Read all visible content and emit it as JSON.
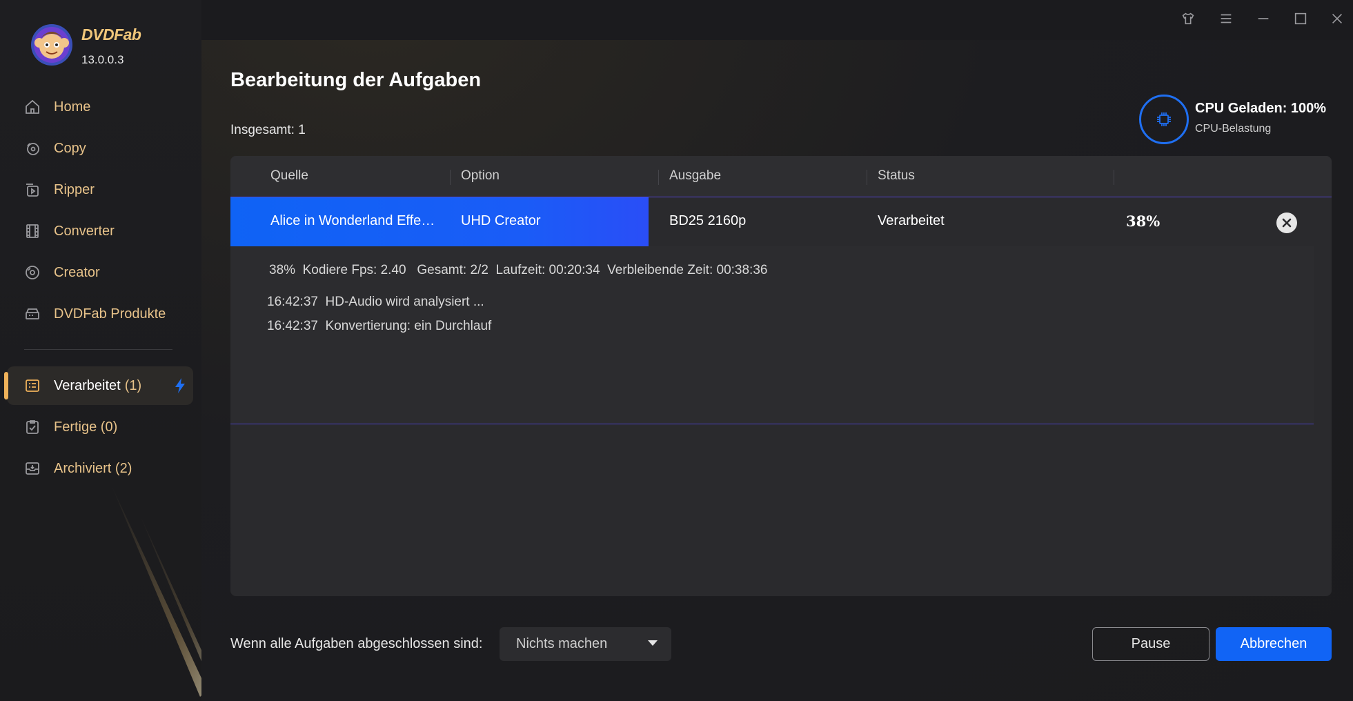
{
  "app": {
    "brand": "DVDFab",
    "version": "13.0.0.3"
  },
  "sidebar": {
    "items": [
      {
        "label": "Home",
        "icon": "home-icon"
      },
      {
        "label": "Copy",
        "icon": "copy-icon"
      },
      {
        "label": "Ripper",
        "icon": "ripper-icon"
      },
      {
        "label": "Converter",
        "icon": "converter-icon"
      },
      {
        "label": "Creator",
        "icon": "creator-icon"
      },
      {
        "label": "DVDFab Produkte",
        "icon": "products-icon"
      }
    ],
    "queue": [
      {
        "label": "Verarbeitet",
        "count": "(1)",
        "icon": "processing-list-icon",
        "active": true
      },
      {
        "label": "Fertige (0)",
        "icon": "finished-icon"
      },
      {
        "label": "Archiviert (2)",
        "icon": "archive-icon"
      }
    ]
  },
  "main": {
    "title": "Bearbeitung der Aufgaben",
    "total": "Insgesamt: 1",
    "cpu": {
      "title": "CPU Geladen: 100%",
      "subtitle": "CPU-Belastung"
    },
    "table": {
      "headers": [
        "Quelle",
        "Option",
        "Ausgabe",
        "Status"
      ],
      "rows": [
        {
          "source": "Alice in Wonderland  Effe…",
          "option": "UHD Creator",
          "output": "BD25 2160p",
          "status": "Verarbeitet",
          "percent": "38%",
          "progress": 0.38
        }
      ],
      "detail": {
        "stats": "38%  Kodiere Fps: 2.40   Gesamt: 2/2  Laufzeit: 00:20:34  Verbleibende Zeit: 00:38:36",
        "log": [
          "16:42:37  HD-Audio wird analysiert ...",
          "16:42:37  Konvertierung: ein Durchlauf"
        ]
      }
    },
    "footer": {
      "label": "Wenn alle Aufgaben abgeschlossen sind:",
      "select_value": "Nichts machen",
      "pause_label": "Pause",
      "cancel_label": "Abbrechen"
    }
  },
  "colors": {
    "accent": "#1164f5",
    "nav_text": "#e8c38a",
    "active_marker": "#f0b25a"
  }
}
